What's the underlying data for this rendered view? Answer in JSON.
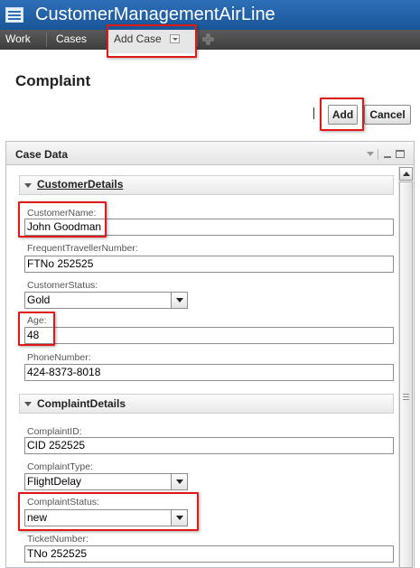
{
  "window": {
    "title": "CustomerManagementAirLine",
    "icon": "app-window-icon"
  },
  "tabs": [
    {
      "label": "Work"
    },
    {
      "label": "Cases"
    },
    {
      "label": "Add Case",
      "active": true
    }
  ],
  "tab_add_icon": "plus-icon",
  "page": {
    "title": "Complaint"
  },
  "toolbar": {
    "add_label": "Add",
    "cancel_label": "Cancel"
  },
  "panel": {
    "title": "Case Data"
  },
  "sections": {
    "customer": {
      "title": "CustomerDetails",
      "fields": {
        "name": {
          "label": "CustomerName:",
          "value": "John Goodman"
        },
        "ftn": {
          "label": "FrequentTravellerNumber:",
          "value": "FTNo 252525"
        },
        "status": {
          "label": "CustomerStatus:",
          "value": "Gold"
        },
        "age": {
          "label": "Age:",
          "value": "48"
        },
        "phone": {
          "label": "PhoneNumber:",
          "value": "424-8373-8018"
        }
      }
    },
    "complaint": {
      "title": "ComplaintDetails",
      "fields": {
        "id": {
          "label": "ComplaintID:",
          "value": "CID 252525"
        },
        "type": {
          "label": "ComplaintType:",
          "value": "FlightDelay"
        },
        "status": {
          "label": "ComplaintStatus:",
          "value": "new"
        },
        "ticket": {
          "label": "TicketNumber:",
          "value": "TNo 252525"
        }
      }
    }
  },
  "colors": {
    "title_bar": "#1f5fa8",
    "tab_bar": "#4a4a4a",
    "highlight": "#e01818"
  }
}
